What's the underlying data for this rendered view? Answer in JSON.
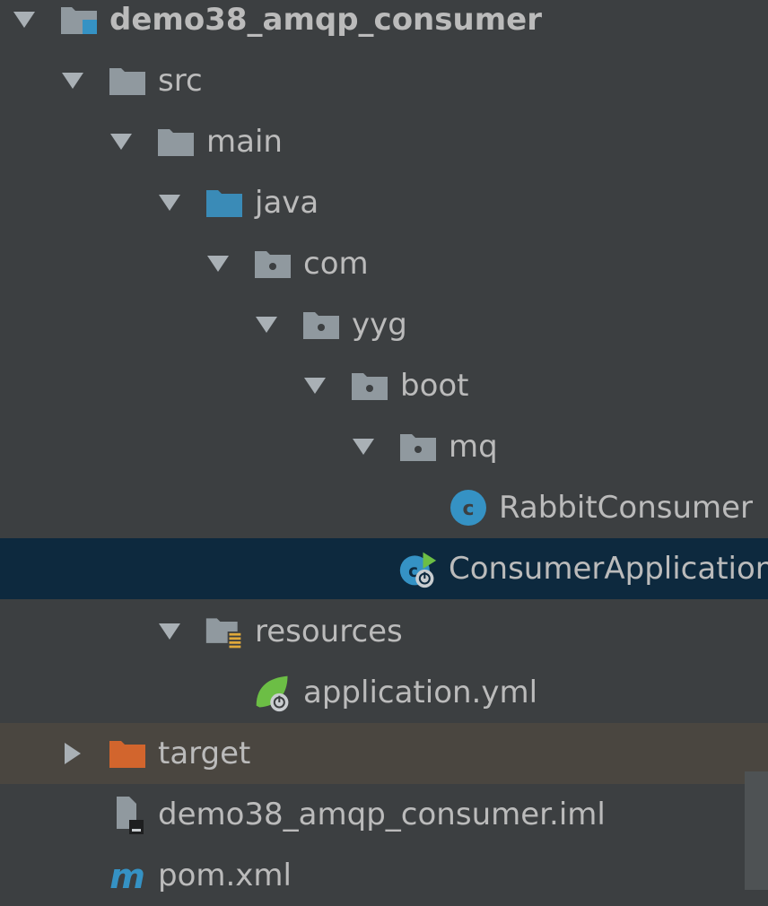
{
  "tree": {
    "items": [
      {
        "label": "demo38_amqp_consumer",
        "icon": "module-folder-icon",
        "expanded": true
      },
      {
        "label": "src",
        "icon": "folder-icon",
        "expanded": true
      },
      {
        "label": "main",
        "icon": "folder-icon",
        "expanded": true
      },
      {
        "label": "java",
        "icon": "source-root-folder-icon",
        "expanded": true
      },
      {
        "label": "com",
        "icon": "package-icon",
        "expanded": true
      },
      {
        "label": "yyg",
        "icon": "package-icon",
        "expanded": true
      },
      {
        "label": "boot",
        "icon": "package-icon",
        "expanded": true
      },
      {
        "label": "mq",
        "icon": "package-icon",
        "expanded": true
      },
      {
        "label": "RabbitConsumer",
        "icon": "java-class-icon"
      },
      {
        "label": "ConsumerApplication",
        "icon": "spring-boot-class-icon",
        "selected": true
      },
      {
        "label": "resources",
        "icon": "resources-folder-icon",
        "expanded": true
      },
      {
        "label": "application.yml",
        "icon": "spring-config-icon"
      },
      {
        "label": "target",
        "icon": "excluded-folder-icon",
        "expanded": false
      },
      {
        "label": "demo38_amqp_consumer.iml",
        "icon": "iml-file-icon"
      },
      {
        "label": "pom.xml",
        "icon": "maven-icon"
      }
    ]
  },
  "colors": {
    "background": "#3c3f41",
    "selection": "#0d293e",
    "excluded_row": "#4a4640",
    "text": "#bbbbbb",
    "folder": "#90999f",
    "source_root": "#3a8bb7",
    "excluded_folder": "#d2652d",
    "spring_green": "#6cbe45"
  }
}
